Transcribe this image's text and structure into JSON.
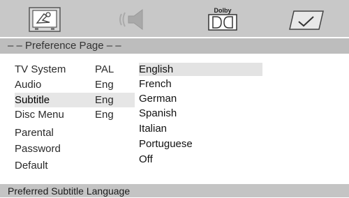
{
  "toolbar": {
    "icons": [
      "tv-setup-icon",
      "speaker-audio-icon",
      "dolby-digital-icon",
      "preference-check-icon"
    ],
    "dolby_text": "Dolby"
  },
  "page_header": "– – Preference Page – –",
  "menu": [
    {
      "label": "TV System",
      "value": "PAL"
    },
    {
      "label": "Audio",
      "value": "Eng"
    },
    {
      "label": "Subtitle",
      "value": "Eng"
    },
    {
      "label": "Disc Menu",
      "value": "Eng"
    },
    {
      "label": "Parental",
      "value": ""
    },
    {
      "label": "Password",
      "value": ""
    },
    {
      "label": "Default",
      "value": ""
    }
  ],
  "options": [
    "English",
    "French",
    "German",
    "Spanish",
    "Italian",
    "Portuguese",
    "Off"
  ],
  "selected_option": "English",
  "status": "Preferred Subtitle Language",
  "colors": {
    "toolbar_bg": "#c8c8c8",
    "header_bg": "#bdbdbd",
    "status_bg": "#c4c4c4",
    "highlight": "#e3e3e3"
  }
}
